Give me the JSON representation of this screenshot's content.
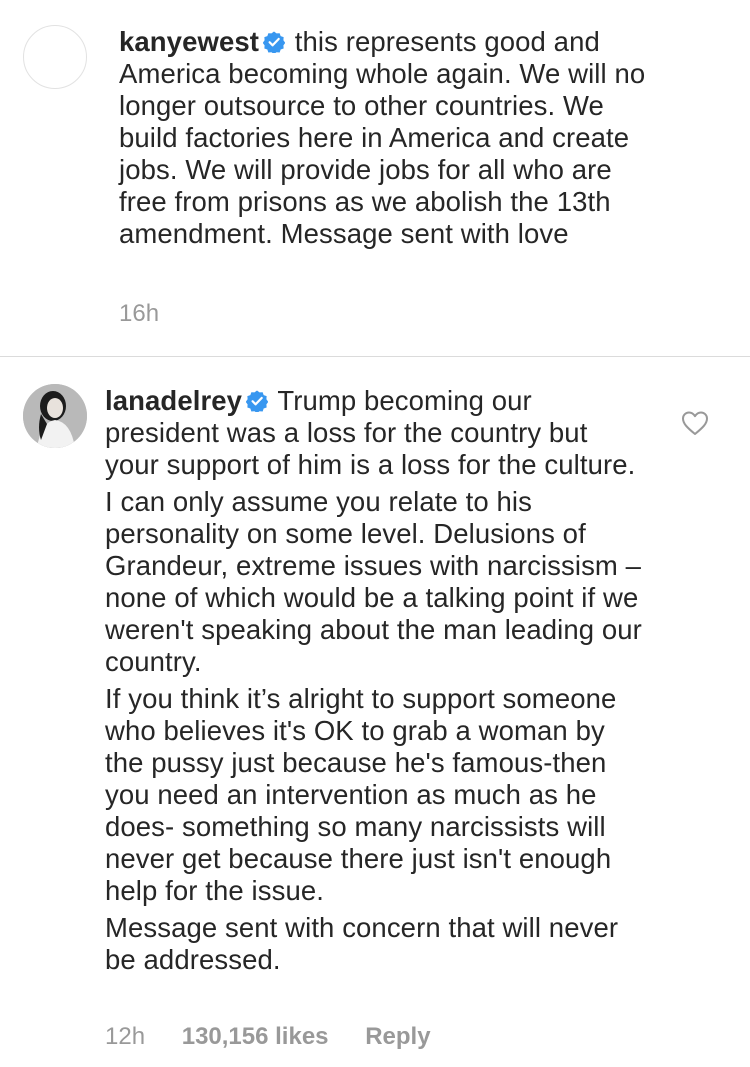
{
  "comments": [
    {
      "username": "kanyewest",
      "verified": true,
      "paragraphs": [
        "this represents good and America becoming whole again.  We will no longer outsource to other countries. We build factories here in America and create jobs.  We will provide jobs for all who are free from prisons as we abolish the 13th amendment. Message sent with love"
      ],
      "time": "16h",
      "avatar": "empty-avatar"
    },
    {
      "username": "lanadelrey",
      "verified": true,
      "paragraphs": [
        "Trump becoming our president was a loss for the country but your support of him is a loss for the culture.",
        "I can only assume you relate to his personality on some level. Delusions of Grandeur, extreme issues with narcissism – none of which would be a talking point if we weren't speaking about the man leading our country.",
        "If you think it’s alright to support someone who believes it's OK to grab a woman by the pussy just because he's famous-then you need an intervention as much as he does- something so many narcissists will never get because there just isn't enough help for the issue.",
        "Message sent with concern that will never be addressed."
      ],
      "time": "12h",
      "likes": "130,156 likes",
      "reply_label": "Reply",
      "avatar": "profile-photo"
    }
  ],
  "icons": {
    "verified": "verified-badge-icon",
    "like": "heart-outline-icon"
  },
  "colors": {
    "text": "#262626",
    "meta": "#999999",
    "verified": "#3897f0",
    "divider": "#dbdbdb"
  }
}
